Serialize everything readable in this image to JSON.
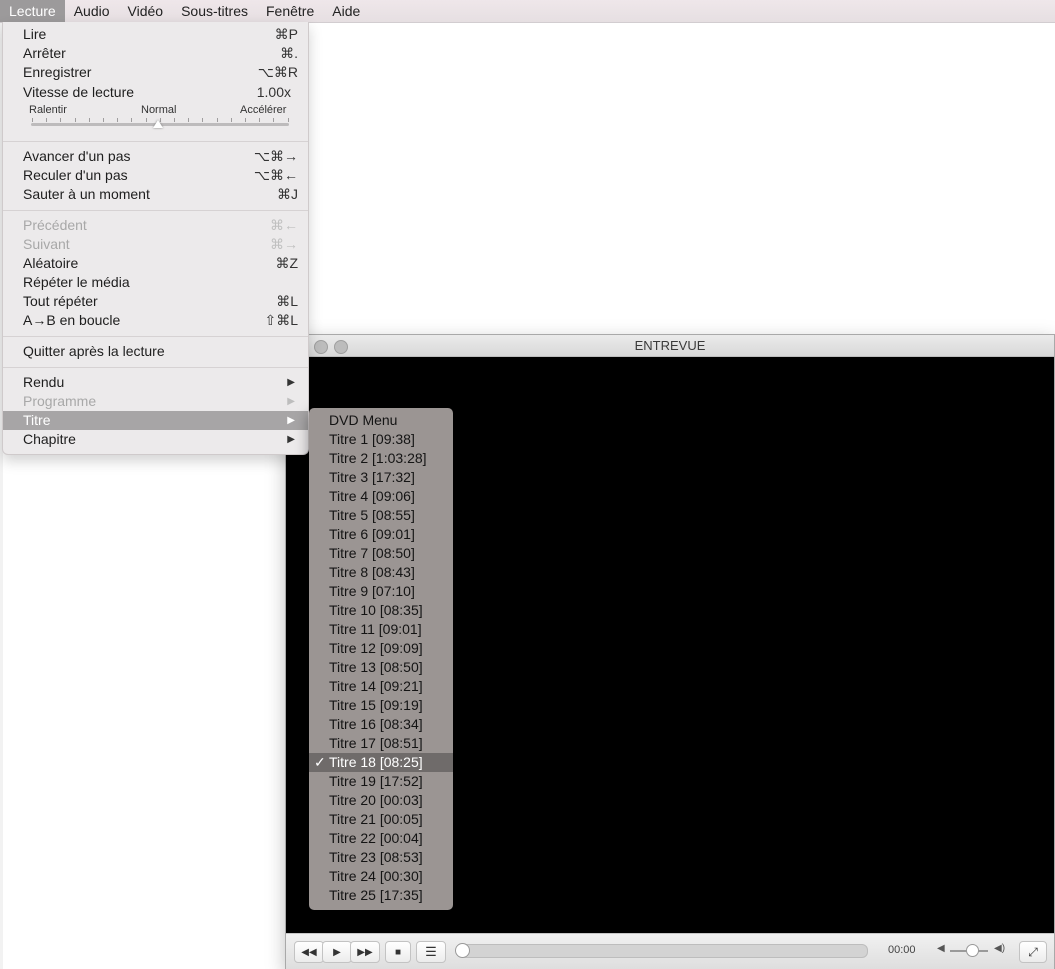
{
  "menubar": {
    "items": [
      "Lecture",
      "Audio",
      "Vidéo",
      "Sous-titres",
      "Fenêtre",
      "Aide"
    ]
  },
  "lecture_menu": {
    "items": [
      {
        "label": "Lire",
        "shortcut": "⌘P"
      },
      {
        "label": "Arrêter",
        "shortcut": "⌘."
      },
      {
        "label": "Enregistrer",
        "shortcut": "⌥⌘R"
      },
      {
        "label": "Vitesse de lecture",
        "shortcut": "1.00x"
      },
      {
        "label": "Avancer d'un pas",
        "shortcut": "⌥⌘→"
      },
      {
        "label": "Reculer d'un pas",
        "shortcut": "⌥⌘←"
      },
      {
        "label": "Sauter à un moment",
        "shortcut": "⌘J"
      },
      {
        "label": "Précédent",
        "shortcut": "⌘←"
      },
      {
        "label": "Suivant",
        "shortcut": "⌘→"
      },
      {
        "label": "Aléatoire",
        "shortcut": "⌘Z"
      },
      {
        "label": "Répéter le média",
        "shortcut": ""
      },
      {
        "label": "Tout répéter",
        "shortcut": "⌘L"
      },
      {
        "label": "A→B en boucle",
        "shortcut": "⇧⌘L"
      },
      {
        "label": "Quitter après la lecture",
        "shortcut": ""
      },
      {
        "label": "Rendu",
        "shortcut": ""
      },
      {
        "label": "Programme",
        "shortcut": ""
      },
      {
        "label": "Titre",
        "shortcut": ""
      },
      {
        "label": "Chapitre",
        "shortcut": ""
      }
    ],
    "speed": {
      "slow": "Ralentir",
      "normal": "Normal",
      "fast": "Accélérer"
    }
  },
  "vlc_window": {
    "title": "ENTREVUE",
    "time": "00:00"
  },
  "titre_submenu": {
    "checkmark": "✓",
    "items": [
      "DVD Menu",
      "Titre 1 [09:38]",
      "Titre 2 [1:03:28]",
      "Titre 3 [17:32]",
      "Titre 4 [09:06]",
      "Titre 5 [08:55]",
      "Titre 6 [09:01]",
      "Titre 7 [08:50]",
      "Titre 8 [08:43]",
      "Titre 9 [07:10]",
      "Titre 10 [08:35]",
      "Titre 11 [09:01]",
      "Titre 12 [09:09]",
      "Titre 13 [08:50]",
      "Titre 14 [09:21]",
      "Titre 15 [09:19]",
      "Titre 16 [08:34]",
      "Titre 17 [08:51]",
      "Titre 18 [08:25]",
      "Titre 19 [17:52]",
      "Titre 20 [00:03]",
      "Titre 21 [00:05]",
      "Titre 22 [00:04]",
      "Titre 23 [08:53]",
      "Titre 24 [00:30]",
      "Titre 25 [17:35]"
    ]
  }
}
